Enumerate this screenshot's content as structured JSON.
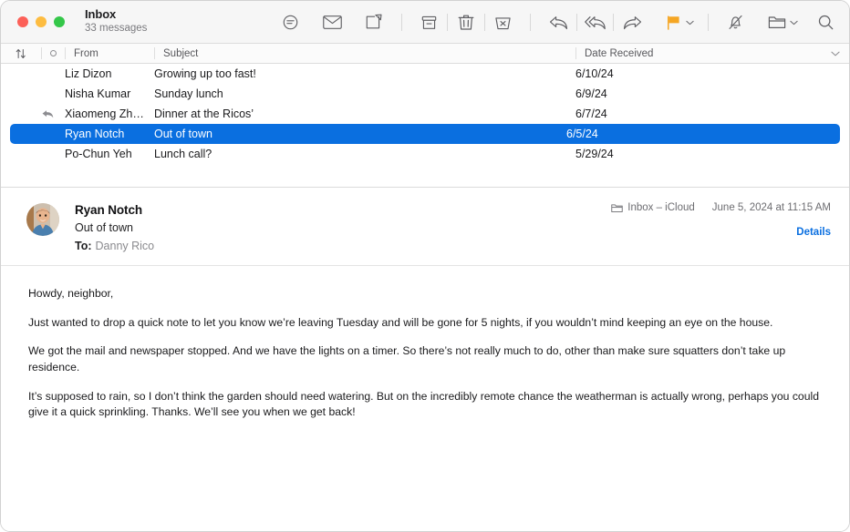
{
  "window": {
    "title": "Inbox",
    "subtitle": "33 messages",
    "traffic_lights": [
      "close",
      "minimize",
      "zoom"
    ],
    "accent_color": "#0a6fe0",
    "flag_color": "#f5a623"
  },
  "toolbar": {
    "items": [
      {
        "name": "filter-icon",
        "label": "Filter"
      },
      {
        "name": "mark-unread-icon",
        "label": "Mark as Unread"
      },
      {
        "name": "compose-icon",
        "label": "New Message"
      },
      {
        "name": "archive-icon",
        "label": "Archive"
      },
      {
        "name": "trash-icon",
        "label": "Delete"
      },
      {
        "name": "junk-icon",
        "label": "Move to Junk"
      },
      {
        "name": "reply-icon",
        "label": "Reply"
      },
      {
        "name": "reply-all-icon",
        "label": "Reply All"
      },
      {
        "name": "forward-icon",
        "label": "Forward"
      },
      {
        "name": "flag-icon",
        "label": "Flag"
      },
      {
        "name": "mute-icon",
        "label": "Mute"
      },
      {
        "name": "move-folder-icon",
        "label": "Move To"
      },
      {
        "name": "search-icon",
        "label": "Search"
      }
    ]
  },
  "columns": {
    "sort": "↑↓",
    "unread": "",
    "from": "From",
    "subject": "Subject",
    "date": "Date Received"
  },
  "messages": [
    {
      "flag": "",
      "from": "Liz Dizon",
      "subject": "Growing up too fast!",
      "date": "6/10/24",
      "selected": false,
      "replied": false
    },
    {
      "flag": "",
      "from": "Nisha Kumar",
      "subject": "Sunday lunch",
      "date": "6/9/24",
      "selected": false,
      "replied": false
    },
    {
      "flag": "",
      "from": "Xiaomeng Zh…",
      "subject": "Dinner at the Ricos’",
      "date": "6/7/24",
      "selected": false,
      "replied": true
    },
    {
      "flag": "",
      "from": "Ryan Notch",
      "subject": "Out of town",
      "date": "6/5/24",
      "selected": true,
      "replied": false
    },
    {
      "flag": "",
      "from": "Po-Chun Yeh",
      "subject": "Lunch call?",
      "date": "5/29/24",
      "selected": false,
      "replied": false
    }
  ],
  "message": {
    "sender": "Ryan Notch",
    "subject": "Out of town",
    "to_label": "To:",
    "to": "Danny Rico",
    "mailbox": "Inbox – iCloud",
    "date": "June 5, 2024 at 11:15 AM",
    "details_label": "Details",
    "body": [
      "Howdy, neighbor,",
      "Just wanted to drop a quick note to let you know we’re leaving Tuesday and will be gone for 5 nights, if you wouldn’t mind keeping an eye on the house.",
      "We got the mail and newspaper stopped. And we have the lights on a timer. So there’s not really much to do, other than make sure squatters don’t take up residence.",
      "It’s supposed to rain, so I don’t think the garden should need watering. But on the incredibly remote chance the weatherman is actually wrong, perhaps you could give it a quick sprinkling. Thanks. We’ll see you when we get back!"
    ]
  }
}
